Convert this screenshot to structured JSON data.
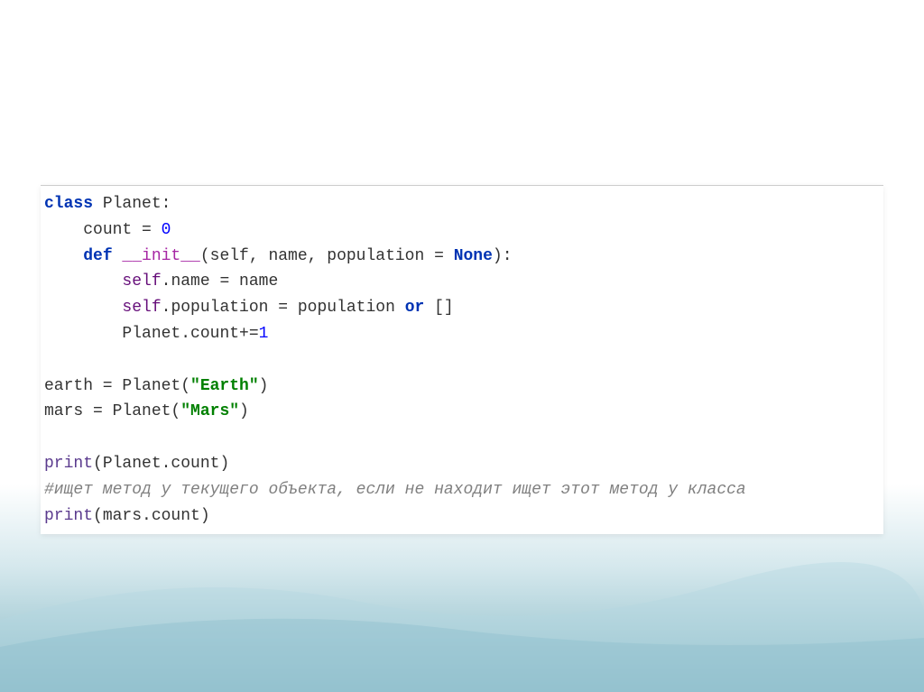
{
  "code": {
    "line1_class": "class",
    "line1_name": " Planet:",
    "line2_indent": "    ",
    "line2_var": "count = ",
    "line2_num": "0",
    "line3_indent": "    ",
    "line3_def": "def",
    "line3_magic": " __init__",
    "line3_params": "(self, name, population = ",
    "line3_none": "None",
    "line3_end": "):",
    "line4_indent": "        ",
    "line4_self": "self",
    "line4_attr": ".name = name",
    "line5_indent": "        ",
    "line5_self": "self",
    "line5_attr": ".population = population ",
    "line5_or": "or",
    "line5_end": " []",
    "line6_indent": "        ",
    "line6_text": "Planet.count+=",
    "line6_num": "1",
    "line7": "",
    "line8_var": "earth = Planet(",
    "line8_str": "\"Earth\"",
    "line8_end": ")",
    "line9_var": "mars = Planet(",
    "line9_str": "\"Mars\"",
    "line9_end": ")",
    "line10": "",
    "line11_print": "print",
    "line11_args": "(Planet.count)",
    "line12_comment": "#ищет метод у текущего объекта, если не находит ищет этот метод у класса",
    "line13_print": "print",
    "line13_args": "(mars.count)"
  }
}
